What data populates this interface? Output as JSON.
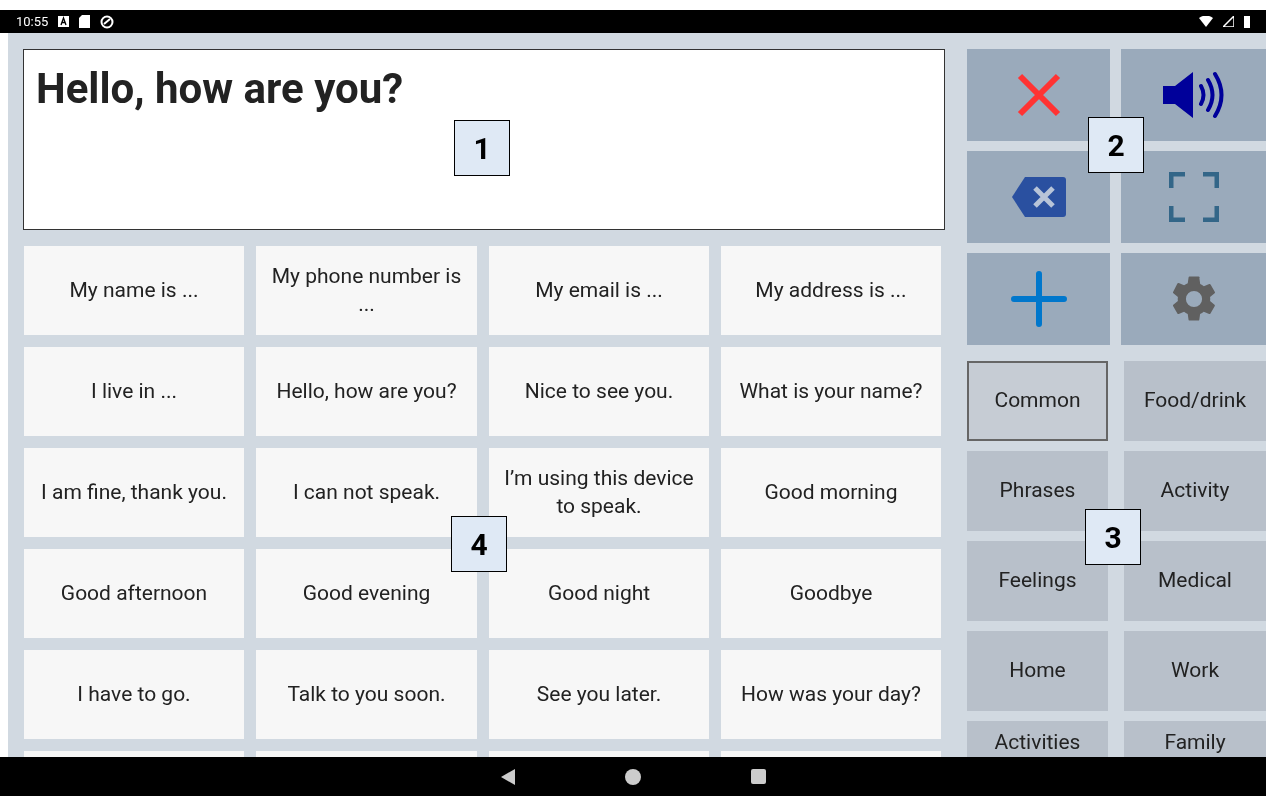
{
  "status_bar": {
    "time": "10:55"
  },
  "message": {
    "text": "Hello, how are you?"
  },
  "phrases": [
    {
      "text": "My name is ..."
    },
    {
      "text": "My phone number is ..."
    },
    {
      "text": "My email is ..."
    },
    {
      "text": "My address is ..."
    },
    {
      "text": "I live in ..."
    },
    {
      "text": "Hello, how are you?"
    },
    {
      "text": "Nice to see you."
    },
    {
      "text": "What is your name?"
    },
    {
      "text": "I am fine, thank you."
    },
    {
      "text": "I can not speak."
    },
    {
      "text": "I’m using this device to speak."
    },
    {
      "text": "Good morning"
    },
    {
      "text": "Good afternoon"
    },
    {
      "text": "Good evening"
    },
    {
      "text": "Good night"
    },
    {
      "text": "Goodbye"
    },
    {
      "text": "I have to go."
    },
    {
      "text": "Talk to you soon."
    },
    {
      "text": "See you later."
    },
    {
      "text": "How was your day?"
    }
  ],
  "actions": [
    {
      "kind": "clear"
    },
    {
      "kind": "speak"
    },
    {
      "kind": "backspace"
    },
    {
      "kind": "fullscreen"
    },
    {
      "kind": "add"
    },
    {
      "kind": "settings"
    }
  ],
  "categories": [
    {
      "label": "Common",
      "selected": true
    },
    {
      "label": "Food/drink",
      "selected": false
    },
    {
      "label": "Phrases",
      "selected": false
    },
    {
      "label": "Activity",
      "selected": false
    },
    {
      "label": "Feelings",
      "selected": false
    },
    {
      "label": "Medical",
      "selected": false
    },
    {
      "label": "Home",
      "selected": false
    },
    {
      "label": "Work",
      "selected": false
    },
    {
      "label": "Activities",
      "selected": false
    },
    {
      "label": "Family",
      "selected": false
    }
  ],
  "callouts": [
    {
      "label": "1"
    },
    {
      "label": "2"
    },
    {
      "label": "4"
    },
    {
      "label": "3"
    }
  ]
}
